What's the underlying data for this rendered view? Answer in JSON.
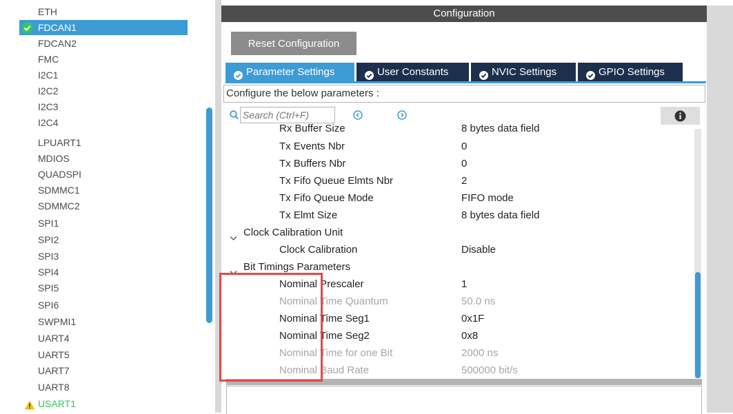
{
  "sidebar": {
    "items": [
      {
        "label": "ETH",
        "state": "normal"
      },
      {
        "label": "FDCAN1",
        "state": "selected",
        "icon": "check-circle-icon"
      },
      {
        "label": "FDCAN2",
        "state": "normal"
      },
      {
        "label": "FMC",
        "state": "normal"
      },
      {
        "label": "I2C1",
        "state": "normal"
      },
      {
        "label": "I2C2",
        "state": "normal"
      },
      {
        "label": "I2C3",
        "state": "normal"
      },
      {
        "label": "I2C4",
        "state": "normal"
      },
      {
        "label": "LPUART1",
        "state": "normal"
      },
      {
        "label": "MDIOS",
        "state": "normal"
      },
      {
        "label": "QUADSPI",
        "state": "normal"
      },
      {
        "label": "SDMMC1",
        "state": "normal"
      },
      {
        "label": "SDMMC2",
        "state": "normal"
      },
      {
        "label": "SPI1",
        "state": "normal"
      },
      {
        "label": "SPI2",
        "state": "normal"
      },
      {
        "label": "SPI3",
        "state": "normal"
      },
      {
        "label": "SPI4",
        "state": "normal"
      },
      {
        "label": "SPI5",
        "state": "normal"
      },
      {
        "label": "SPI6",
        "state": "normal"
      },
      {
        "label": "SWPMI1",
        "state": "normal"
      },
      {
        "label": "UART4",
        "state": "normal"
      },
      {
        "label": "UART5",
        "state": "normal"
      },
      {
        "label": "UART7",
        "state": "normal"
      },
      {
        "label": "UART8",
        "state": "normal"
      },
      {
        "label": "USART1",
        "state": "warning",
        "icon": "warning-triangle-icon"
      }
    ]
  },
  "config": {
    "title": "Configuration",
    "reset_label": "Reset Configuration",
    "tabs": [
      {
        "label": "Parameter Settings",
        "active": true,
        "icon": "check-circle-icon"
      },
      {
        "label": "User Constants",
        "active": false,
        "icon": "check-circle-icon"
      },
      {
        "label": "NVIC Settings",
        "active": false,
        "icon": "check-circle-icon"
      },
      {
        "label": "GPIO Settings",
        "active": false,
        "icon": "check-circle-icon"
      }
    ],
    "description": "Configure the below parameters :",
    "search_placeholder": "Search (Ctrl+F)",
    "params": [
      {
        "label": "Rx Buffer Size",
        "value": "8 bytes data field",
        "type": "param"
      },
      {
        "label": "Tx Events Nbr",
        "value": "0",
        "type": "param"
      },
      {
        "label": "Tx Buffers Nbr",
        "value": "0",
        "type": "param"
      },
      {
        "label": "Tx Fifo Queue Elmts Nbr",
        "value": "2",
        "type": "param"
      },
      {
        "label": "Tx Fifo Queue Mode",
        "value": "FIFO mode",
        "type": "param"
      },
      {
        "label": "Tx Elmt Size",
        "value": "8 bytes data field",
        "type": "param"
      },
      {
        "label": "Clock Calibration Unit",
        "value": "",
        "type": "group"
      },
      {
        "label": "Clock Calibration",
        "value": "Disable",
        "type": "param"
      },
      {
        "label": "Bit Timings Parameters",
        "value": "",
        "type": "group"
      },
      {
        "label": "Nominal Prescaler",
        "value": "1",
        "type": "param"
      },
      {
        "label": "Nominal Time Quantum",
        "value": "50.0 ns",
        "type": "readonly"
      },
      {
        "label": "Nominal Time Seg1",
        "value": "0x1F",
        "type": "param"
      },
      {
        "label": "Nominal Time Seg2",
        "value": "0x8",
        "type": "param"
      },
      {
        "label": "Nominal Time for one Bit",
        "value": "2000 ns",
        "type": "readonly"
      },
      {
        "label": "Nominal Baud Rate",
        "value": "500000 bit/s",
        "type": "readonly"
      }
    ]
  },
  "colors": {
    "accent": "#3d9bd6",
    "tab_inactive": "#1c2f4d",
    "highlight": "#e54848",
    "warning": "#f5c518",
    "ok": "#34c759"
  }
}
